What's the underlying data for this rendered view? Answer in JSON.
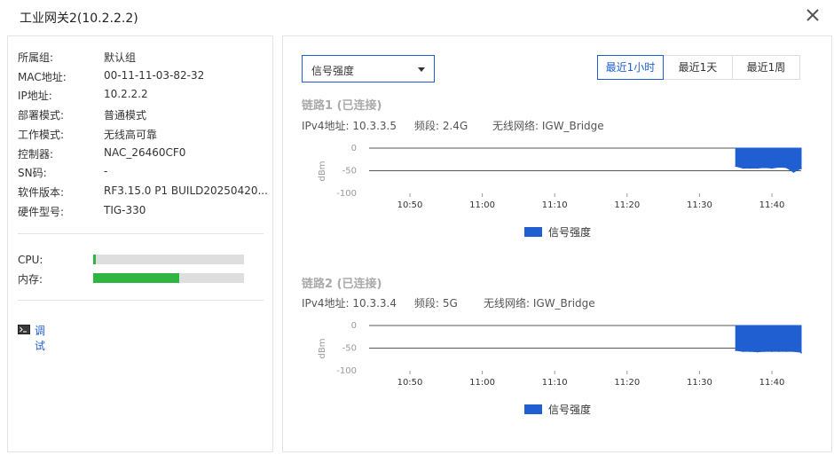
{
  "window": {
    "title": "工业网关2(10.2.2.2)",
    "close_icon": "close-icon"
  },
  "device_info": [
    {
      "key": "所属组:",
      "value": "默认组"
    },
    {
      "key": "MAC地址:",
      "value": "00-11-11-03-82-32"
    },
    {
      "key": "IP地址:",
      "value": "10.2.2.2"
    },
    {
      "key": "部署模式:",
      "value": "普通模式"
    },
    {
      "key": "工作模式:",
      "value": "无线高可靠"
    },
    {
      "key": "控制器:",
      "value": "NAC_26460CF0"
    },
    {
      "key": "SN码:",
      "value": "-"
    },
    {
      "key": "软件版本:",
      "value": "RF3.15.0 P1 BUILD20250420..."
    },
    {
      "key": "硬件型号:",
      "value": "TIG-330"
    }
  ],
  "resources": [
    {
      "label": "CPU:",
      "percent": 2,
      "color": "#2fb541"
    },
    {
      "label": "内存:",
      "percent": 57,
      "color": "#2fb541"
    }
  ],
  "debug": {
    "label": "调试",
    "icon": "terminal-icon"
  },
  "metric_select": {
    "value": "信号强度",
    "icon": "caret-down-icon"
  },
  "time_range": {
    "options": [
      "最近1小时",
      "最近1天",
      "最近1周"
    ],
    "active_index": 0,
    "active_color": "#1f5fd1"
  },
  "links": [
    {
      "title": "链路1 (已连接)",
      "ipv4_label": "IPv4地址: 10.3.3.5",
      "band_label": "频段: 2.4G",
      "ssid_label": "无线网络: IGW_Bridge"
    },
    {
      "title": "链路2 (已连接)",
      "ipv4_label": "IPv4地址: 10.3.3.4",
      "band_label": "频段: 5G",
      "ssid_label": "无线网络: IGW_Bridge"
    }
  ],
  "chart_data": [
    {
      "type": "area",
      "ylabel": "dBm",
      "ylim": [
        -100,
        0
      ],
      "yticks": [
        0,
        -50,
        -100
      ],
      "ytick_labels": [
        "0",
        "-50",
        "-100"
      ],
      "xlim_minutes": [
        40,
        100
      ],
      "xticks": [
        "10:50",
        "11:00",
        "11:10",
        "11:20",
        "11:30",
        "11:40"
      ],
      "xtick_minutes": [
        50,
        60,
        70,
        80,
        90,
        100
      ],
      "legend": "信号强度",
      "legend_position": "bottom-center",
      "color": "#1f5fd1",
      "grid_y_values": [
        0,
        -50
      ],
      "series": [
        {
          "name": "信号强度",
          "x": [
            "11:35",
            "11:36",
            "11:37",
            "11:38",
            "11:39",
            "11:40",
            "11:41",
            "11:42",
            "11:43",
            "11:44",
            "11:45"
          ],
          "x_minutes": [
            95,
            96,
            97,
            98,
            99,
            100,
            101,
            102,
            103,
            104,
            105
          ],
          "values": [
            -40,
            -44,
            -44,
            -44,
            -43,
            -44,
            -42,
            -43,
            -53,
            -45,
            -45
          ]
        }
      ]
    },
    {
      "type": "area",
      "ylabel": "dBm",
      "ylim": [
        -100,
        0
      ],
      "yticks": [
        0,
        -50,
        -100
      ],
      "ytick_labels": [
        "0",
        "-50",
        "-100"
      ],
      "xlim_minutes": [
        40,
        100
      ],
      "xticks": [
        "10:50",
        "11:00",
        "11:10",
        "11:20",
        "11:30",
        "11:40"
      ],
      "xtick_minutes": [
        50,
        60,
        70,
        80,
        90,
        100
      ],
      "legend": "信号强度",
      "legend_position": "bottom-center",
      "color": "#1f5fd1",
      "grid_y_values": [
        0,
        -50
      ],
      "series": [
        {
          "name": "信号强度",
          "x": [
            "11:35",
            "11:36",
            "11:37",
            "11:38",
            "11:39",
            "11:40",
            "11:41",
            "11:42",
            "11:43",
            "11:44",
            "11:45"
          ],
          "x_minutes": [
            95,
            96,
            97,
            98,
            99,
            100,
            101,
            102,
            103,
            104,
            105
          ],
          "values": [
            -55,
            -57,
            -57,
            -58,
            -57,
            -57,
            -57,
            -57,
            -57,
            -59,
            -60
          ]
        }
      ]
    }
  ]
}
